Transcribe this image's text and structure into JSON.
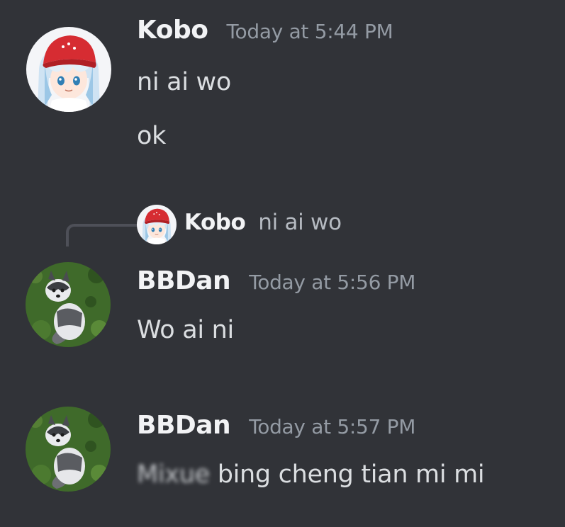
{
  "messages": [
    {
      "author": "Kobo",
      "timestamp": "Today at 5:44 PM",
      "avatar_icon": "anime-girl-red-cap-avatar",
      "lines": [
        "ni ai wo",
        "ok"
      ]
    },
    {
      "author": "BBDan",
      "timestamp": "Today at 5:56 PM",
      "avatar_icon": "husky-puppy-avatar",
      "reply": {
        "author": "Kobo",
        "preview": "ni ai wo"
      },
      "lines": [
        "Wo ai ni"
      ]
    },
    {
      "author": "BBDan",
      "timestamp": "Today at 5:57 PM",
      "avatar_icon": "husky-puppy-avatar",
      "redacted_prefix": "Mixue",
      "lines": [
        "bing cheng tian mi mi"
      ]
    }
  ],
  "colors": {
    "background": "#313338",
    "username": "#f2f3f5",
    "timestamp": "#949ba4",
    "message_text": "#dbdee1",
    "reply_spine": "#4e5058"
  }
}
